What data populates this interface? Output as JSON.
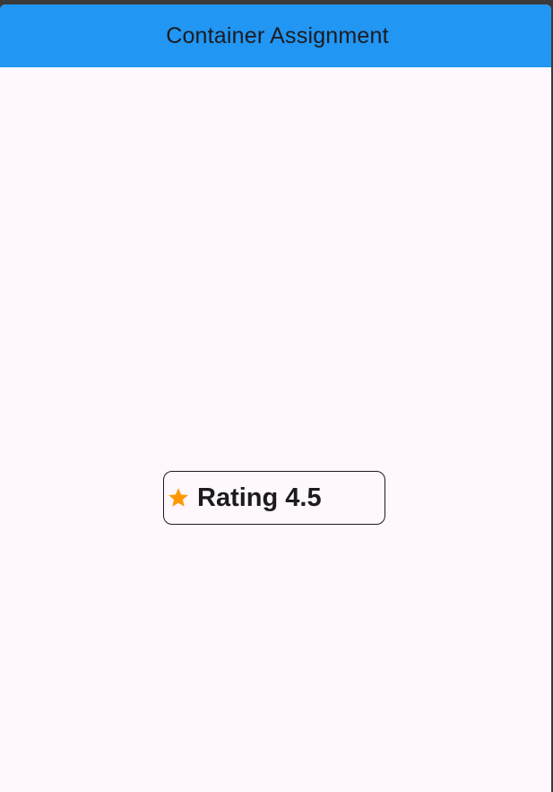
{
  "app_bar": {
    "title": "Container Assignment",
    "color": "#2196f3"
  },
  "rating_card": {
    "icon": "star-icon",
    "icon_color": "#ff9800",
    "label": "Rating 4.5",
    "value": 4.5
  },
  "colors": {
    "background": "#fef7fe",
    "text": "#1d1b20"
  }
}
